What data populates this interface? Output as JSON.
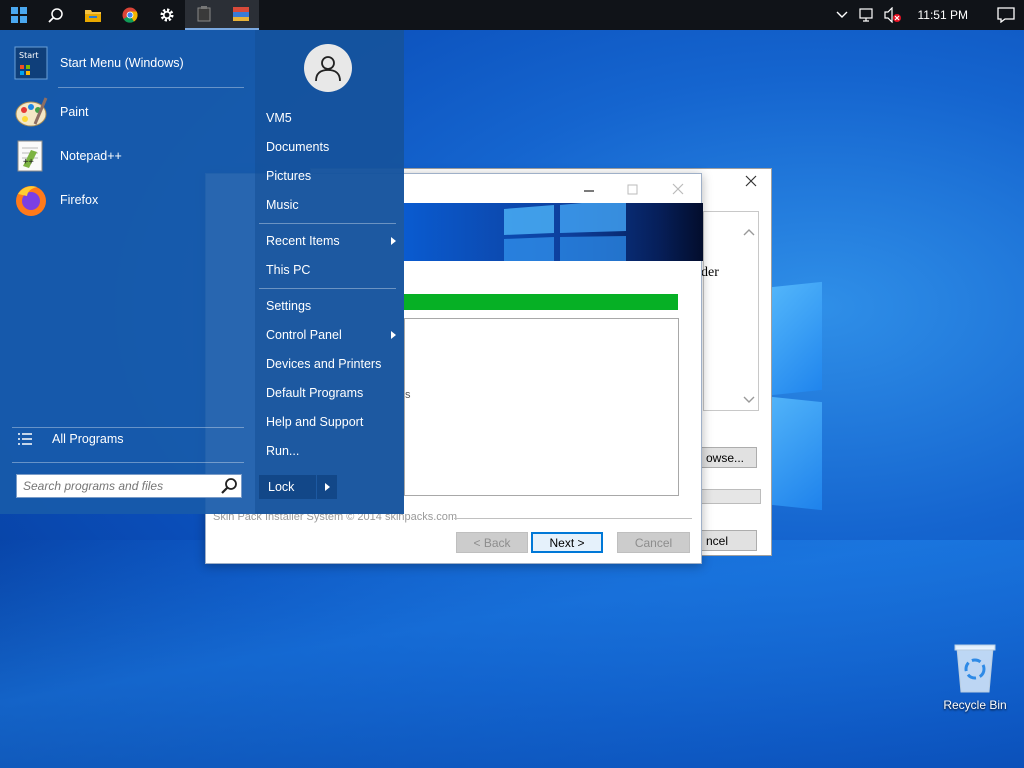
{
  "taskbar": {
    "clock": "11:51 PM",
    "icons": [
      "windows-icon",
      "search-icon",
      "file-explorer-icon",
      "chrome-icon",
      "gear-icon",
      "app-icon",
      "installer-icon"
    ],
    "tray_icons": [
      "chevron-up-icon",
      "network-icon",
      "volume-muted-icon",
      "notification-icon"
    ]
  },
  "start_menu": {
    "programs": [
      {
        "label": "Start Menu (Windows)",
        "icon": "start-menu-icon"
      },
      {
        "label": "Paint",
        "icon": "paint-icon"
      },
      {
        "label": "Notepad++",
        "icon": "notepadpp-icon"
      },
      {
        "label": "Firefox",
        "icon": "firefox-icon"
      }
    ],
    "all_programs": "All Programs",
    "search_placeholder": "Search programs and files",
    "right": {
      "user": "VM5",
      "documents": "Documents",
      "pictures": "Pictures",
      "music": "Music",
      "recent_items": "Recent Items",
      "this_pc": "This PC",
      "settings": "Settings",
      "control_panel": "Control Panel",
      "devices_printers": "Devices and Printers",
      "default_programs": "Default Programs",
      "help_support": "Help and Support",
      "run": "Run...",
      "lock": "Lock"
    }
  },
  "installer": {
    "footer": "Skin Pack Installer System © 2014 skinpacks.com",
    "back_label": "< Back",
    "next_label": "Next >",
    "cancel_label": "Cancel",
    "progress": 1.0,
    "progress_color": "#06b025",
    "fragment_s": "s"
  },
  "back_dialog": {
    "text_fragment": "der",
    "browse_label": "owse...",
    "cancel_label": "ncel"
  },
  "desktop": {
    "recycle_bin": "Recycle Bin"
  }
}
